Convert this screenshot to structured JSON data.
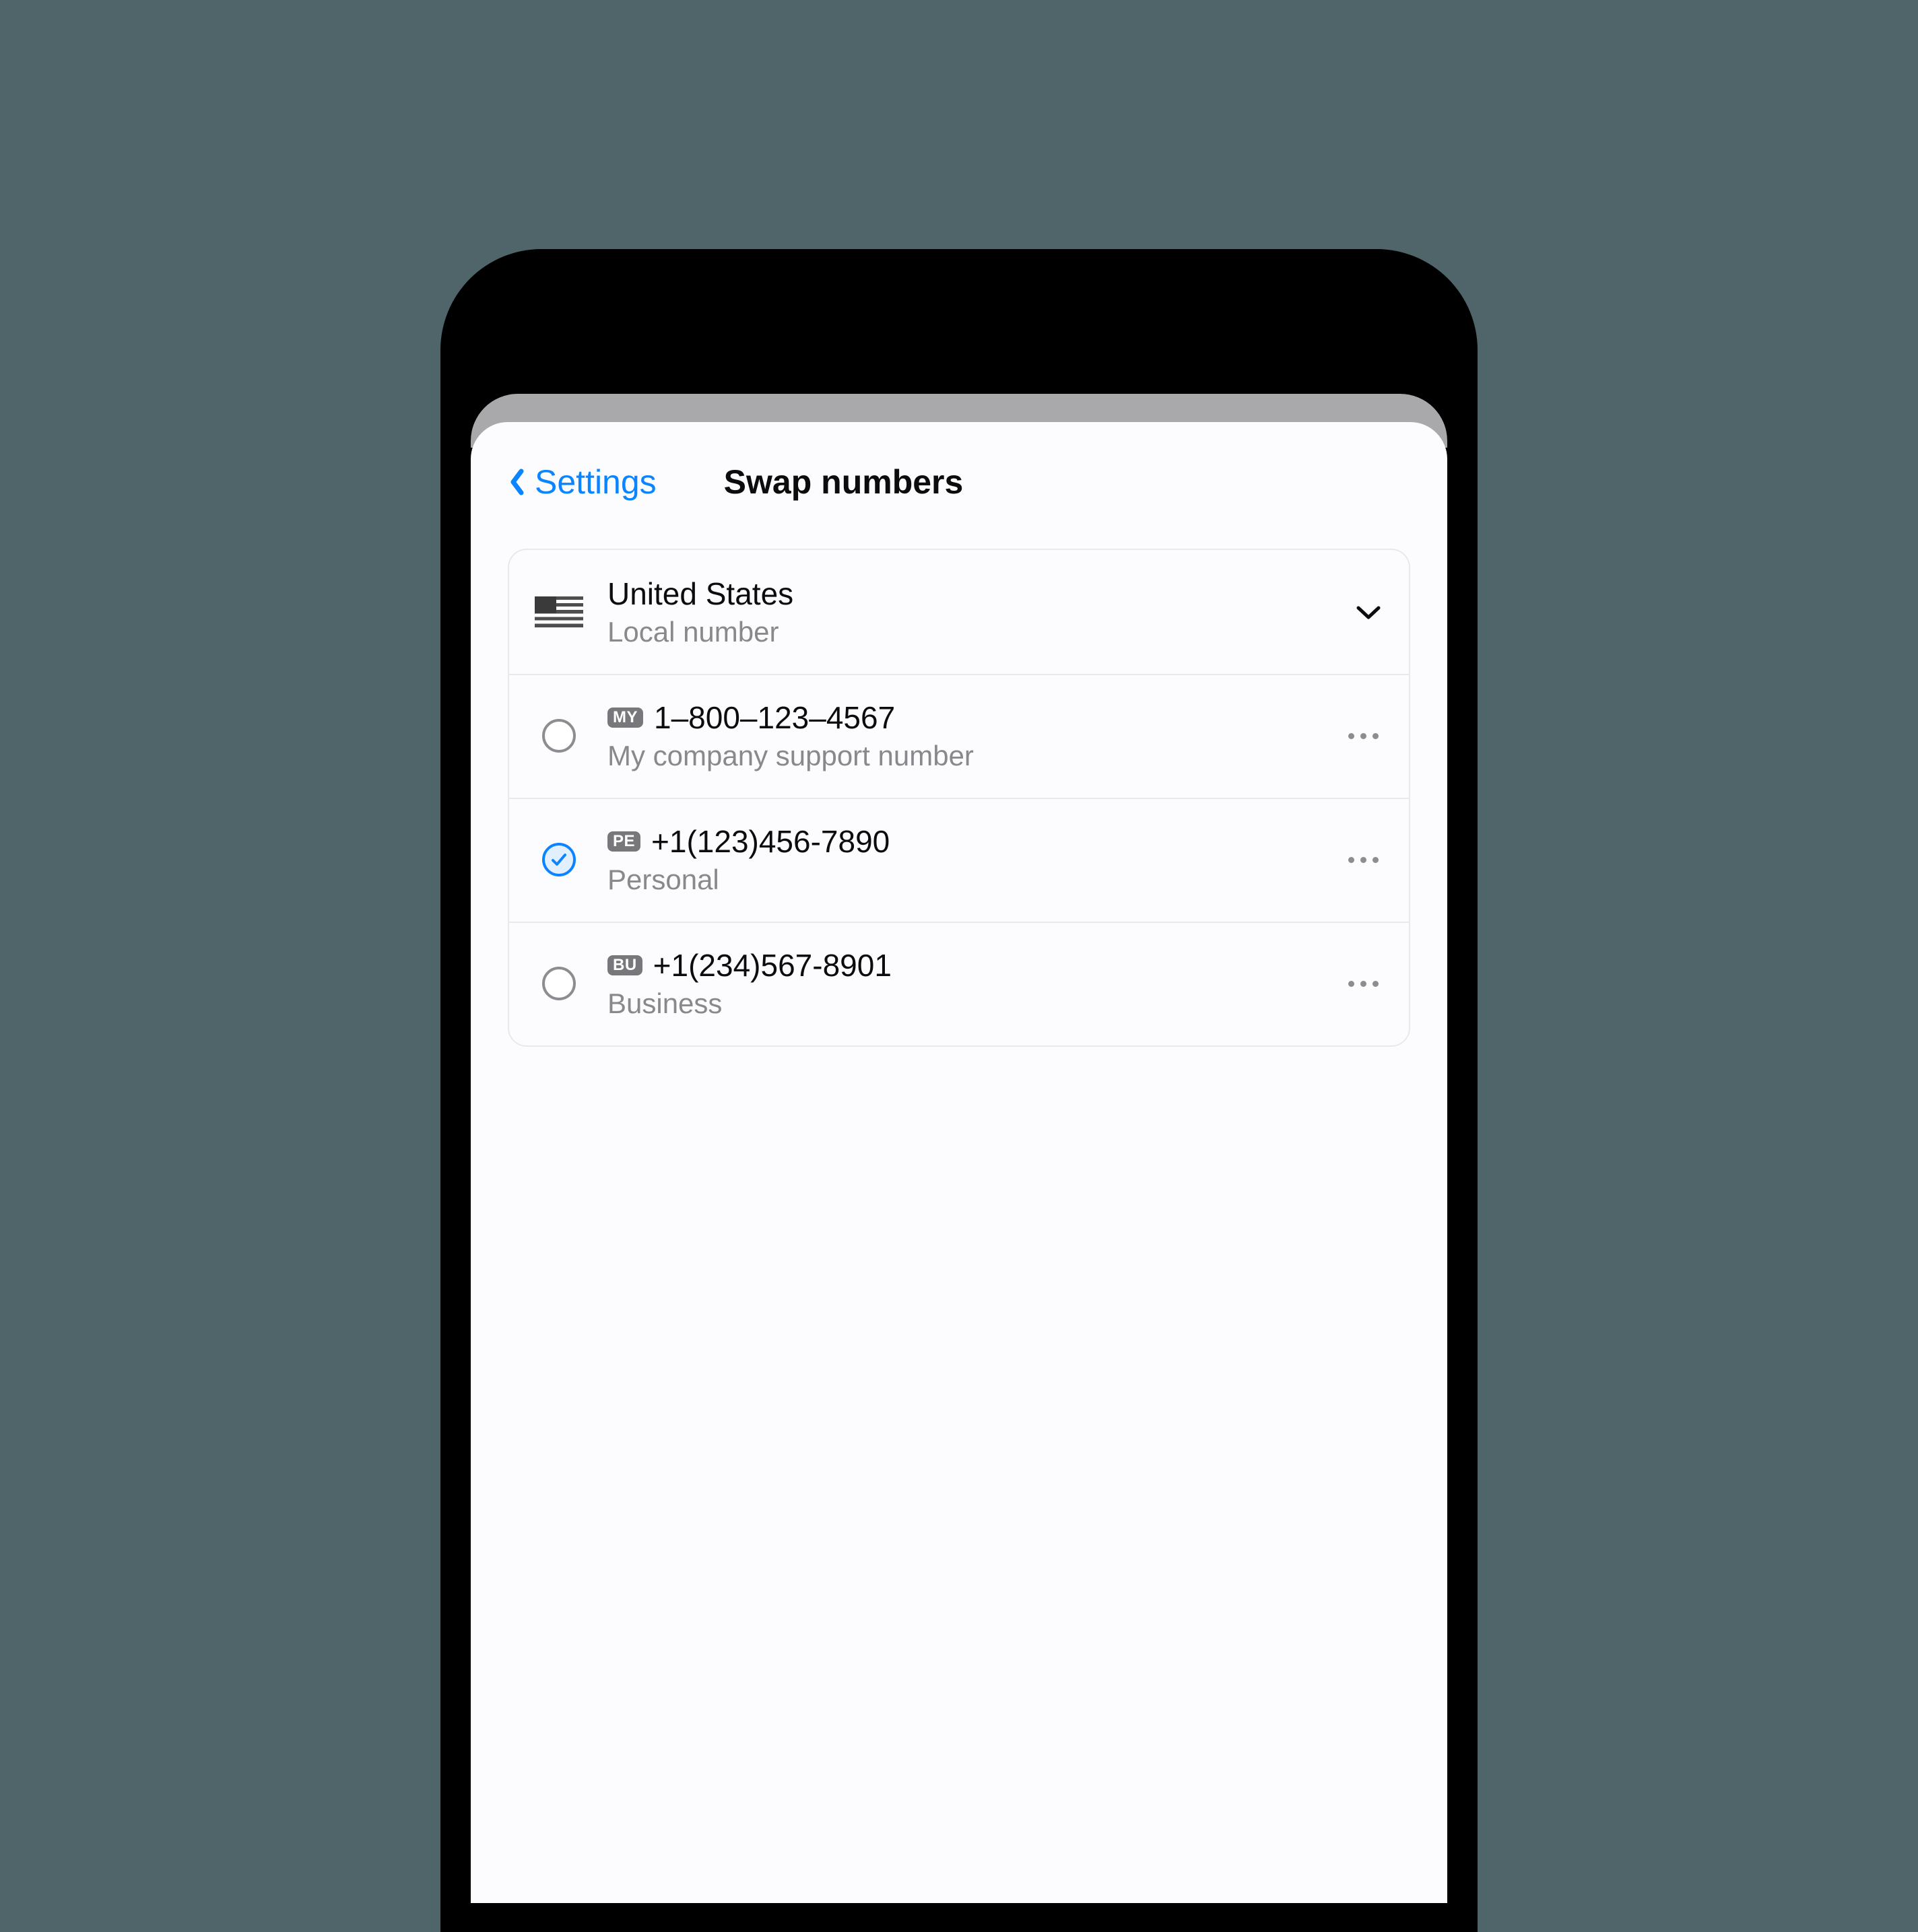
{
  "nav": {
    "back_label": "Settings",
    "title": "Swap numbers"
  },
  "country_selector": {
    "country": "United States",
    "subtitle": "Local number"
  },
  "numbers": [
    {
      "tag": "MY",
      "number": "1–800–123–4567",
      "label": "My company support number",
      "selected": false
    },
    {
      "tag": "PE",
      "number": "+1(123)456-7890",
      "label": "Personal",
      "selected": true
    },
    {
      "tag": "BU",
      "number": "+1(234)567-8901",
      "label": "Business",
      "selected": false
    }
  ]
}
